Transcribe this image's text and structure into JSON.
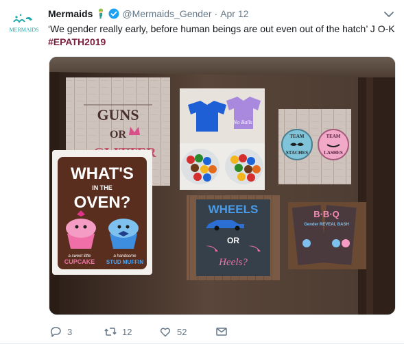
{
  "tweet": {
    "display_name": "Mermaids",
    "handle": "@Mermaids_Gender",
    "separator": "·",
    "date": "Apr 12",
    "text": "‘We gender really early, before human beings are out even out of the hatch’ J O-K",
    "hashtag": "#EPATH2019",
    "avatar_label": "MERMAIDS",
    "verified": true
  },
  "media": {
    "slides": {
      "guns_line1": "GUNS",
      "guns_line2": "OR",
      "guns_line3": "GLITTER",
      "onesie_right": "No Balls",
      "team_left_1": "TEAM",
      "team_left_2": "STACHES",
      "team_right_1": "TEAM",
      "team_right_2": "LASHES",
      "oven_1": "WHAT'S",
      "oven_2": "IN THE",
      "oven_3": "OVEN?",
      "oven_left_small": "a sweet little",
      "oven_left_big": "CUPCAKE",
      "oven_right_small": "a handsome",
      "oven_right_big": "STUD MUFFIN",
      "wheels_1": "WHEELS",
      "wheels_2": "OR",
      "wheels_3": "Heels?",
      "bbq_1": "B·B·Q",
      "bbq_2": "Gender REVEAL BASH"
    }
  },
  "actions": {
    "replies": "3",
    "retweets": "12",
    "likes": "52"
  },
  "colors": {
    "hashtag": "#7b1f3e",
    "muted": "#657786",
    "verified": "#1da1f2"
  }
}
